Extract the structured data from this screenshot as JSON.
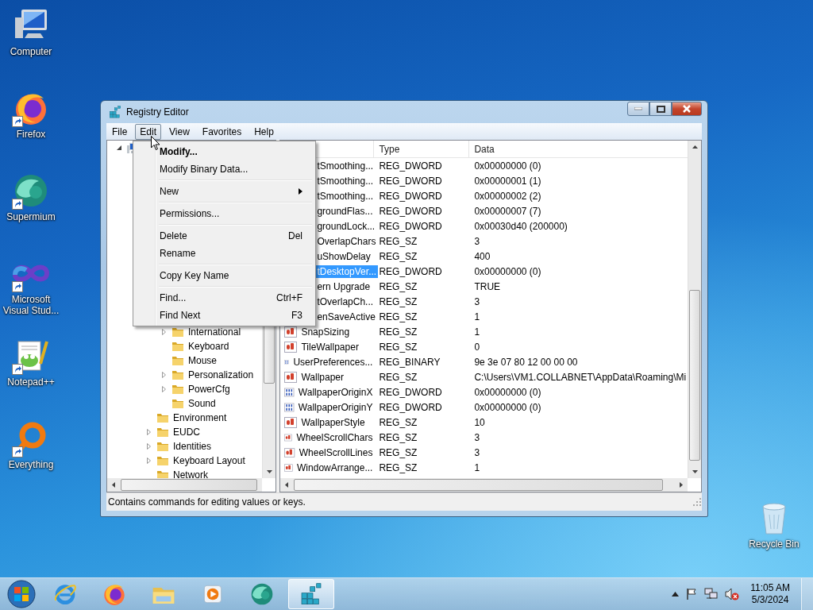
{
  "desktop_icons": [
    {
      "kind": "computer",
      "label": "Computer",
      "shortcut": false
    },
    {
      "kind": "firefox",
      "label": "Firefox",
      "shortcut": true
    },
    {
      "kind": "supermium",
      "label": "Supermium",
      "shortcut": true
    },
    {
      "kind": "vstudio",
      "label": "Microsoft Visual Stud...",
      "shortcut": true
    },
    {
      "kind": "notepad",
      "label": "Notepad++",
      "shortcut": true
    },
    {
      "kind": "everything",
      "label": "Everything",
      "shortcut": true
    }
  ],
  "recycle_bin": {
    "label": "Recycle Bin"
  },
  "window": {
    "title": "Registry Editor"
  },
  "menu_bar": [
    {
      "label": "File",
      "selected": false
    },
    {
      "label": "Edit",
      "selected": true
    },
    {
      "label": "View",
      "selected": false
    },
    {
      "label": "Favorites",
      "selected": false
    },
    {
      "label": "Help",
      "selected": false
    }
  ],
  "edit_menu": [
    {
      "kind": "item",
      "label": "Modify...",
      "default": true,
      "submenu": false
    },
    {
      "kind": "item",
      "label": "Modify Binary Data...",
      "default": false,
      "submenu": false
    },
    {
      "kind": "separator"
    },
    {
      "kind": "item",
      "label": "New",
      "default": false,
      "submenu": true
    },
    {
      "kind": "separator"
    },
    {
      "kind": "item",
      "label": "Permissions...",
      "default": false,
      "submenu": false
    },
    {
      "kind": "separator"
    },
    {
      "kind": "item",
      "label": "Delete",
      "shortcut": "Del",
      "default": false,
      "submenu": false
    },
    {
      "kind": "item",
      "label": "Rename",
      "default": false,
      "submenu": false
    },
    {
      "kind": "separator"
    },
    {
      "kind": "item",
      "label": "Copy Key Name",
      "default": false,
      "submenu": false
    },
    {
      "kind": "separator"
    },
    {
      "kind": "item",
      "label": "Find...",
      "shortcut": "Ctrl+F",
      "default": false,
      "submenu": false
    },
    {
      "kind": "item",
      "label": "Find Next",
      "shortcut": "F3",
      "default": false,
      "submenu": false
    }
  ],
  "tree": {
    "root": {
      "expanded": true,
      "children": [
        {
          "children": [
            {
              "label": "International",
              "expandable": true
            },
            {
              "label": "Keyboard",
              "expandable": false
            },
            {
              "label": "Mouse",
              "expandable": false
            },
            {
              "label": "Personalization",
              "expandable": true
            },
            {
              "label": "PowerCfg",
              "expandable": true
            },
            {
              "label": "Sound",
              "expandable": false
            }
          ]
        },
        {
          "label": "Environment",
          "expandable": false
        },
        {
          "label": "EUDC",
          "expandable": true
        },
        {
          "label": "Identities",
          "expandable": true
        },
        {
          "label": "Keyboard Layout",
          "expandable": true
        },
        {
          "label": "Network",
          "expandable": false
        }
      ]
    }
  },
  "values": {
    "columns": [
      "Type",
      "Data"
    ],
    "rows": [
      {
        "kind": "covered",
        "name": "tSmoothing...",
        "type": "REG_DWORD",
        "data": "0x00000000 (0)",
        "selected": false
      },
      {
        "kind": "covered",
        "name": "tSmoothing...",
        "type": "REG_DWORD",
        "data": "0x00000001 (1)",
        "selected": false
      },
      {
        "kind": "covered",
        "name": "tSmoothing...",
        "type": "REG_DWORD",
        "data": "0x00000002 (2)",
        "selected": false
      },
      {
        "kind": "covered",
        "name": "groundFlas...",
        "type": "REG_DWORD",
        "data": "0x00000007 (7)",
        "selected": false
      },
      {
        "kind": "covered",
        "name": "groundLock...",
        "type": "REG_DWORD",
        "data": "0x00030d40 (200000)",
        "selected": false
      },
      {
        "kind": "covered",
        "name": "OverlapChars",
        "type": "REG_SZ",
        "data": "3",
        "selected": false
      },
      {
        "kind": "covered",
        "name": "uShowDelay",
        "type": "REG_SZ",
        "data": "400",
        "selected": false
      },
      {
        "kind": "covered",
        "name": "tDesktopVer...",
        "type": "REG_DWORD",
        "data": "0x00000000 (0)",
        "selected": true
      },
      {
        "kind": "covered",
        "name": "ern Upgrade",
        "type": "REG_SZ",
        "data": "TRUE",
        "selected": false
      },
      {
        "kind": "covered",
        "name": "tOverlapCh...",
        "type": "REG_SZ",
        "data": "3",
        "selected": false
      },
      {
        "kind": "covered",
        "name": "enSaveActive",
        "type": "REG_SZ",
        "data": "1",
        "selected": false
      },
      {
        "kind": "string",
        "name": "SnapSizing",
        "type": "REG_SZ",
        "data": "1",
        "selected": false
      },
      {
        "kind": "string",
        "name": "TileWallpaper",
        "type": "REG_SZ",
        "data": "0",
        "selected": false
      },
      {
        "kind": "binary",
        "name": "UserPreferences...",
        "type": "REG_BINARY",
        "data": "9e 3e 07 80 12 00 00 00",
        "selected": false
      },
      {
        "kind": "string",
        "name": "Wallpaper",
        "type": "REG_SZ",
        "data": "C:\\Users\\VM1.COLLABNET\\AppData\\Roaming\\Mi",
        "selected": false
      },
      {
        "kind": "binary",
        "name": "WallpaperOriginX",
        "type": "REG_DWORD",
        "data": "0x00000000 (0)",
        "selected": false
      },
      {
        "kind": "binary",
        "name": "WallpaperOriginY",
        "type": "REG_DWORD",
        "data": "0x00000000 (0)",
        "selected": false
      },
      {
        "kind": "string",
        "name": "WallpaperStyle",
        "type": "REG_SZ",
        "data": "10",
        "selected": false
      },
      {
        "kind": "string",
        "name": "WheelScrollChars",
        "type": "REG_SZ",
        "data": "3",
        "selected": false
      },
      {
        "kind": "string",
        "name": "WheelScrollLines",
        "type": "REG_SZ",
        "data": "3",
        "selected": false
      },
      {
        "kind": "string",
        "name": "WindowArrange...",
        "type": "REG_SZ",
        "data": "1",
        "selected": false
      }
    ]
  },
  "status_bar": {
    "text": "Contains commands for editing values or keys."
  },
  "taskbar": {
    "apps": [
      {
        "kind": "ie",
        "active": false
      },
      {
        "kind": "firefox",
        "active": false
      },
      {
        "kind": "explorer",
        "active": false
      },
      {
        "kind": "media",
        "active": false
      },
      {
        "kind": "supermium",
        "active": false
      },
      {
        "kind": "regedit",
        "active": true
      }
    ],
    "clock": {
      "time": "11:05 AM",
      "date": "5/3/2024"
    }
  }
}
